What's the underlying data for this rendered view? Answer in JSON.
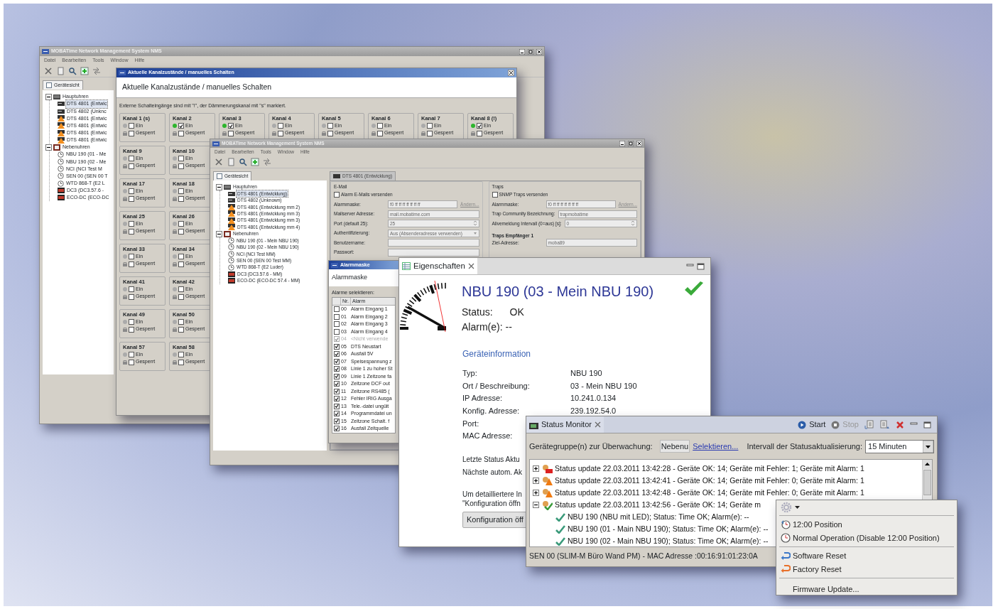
{
  "main_window": {
    "title": "MOBATime Network Management System NMS",
    "menu": [
      "Datei",
      "Bearbeiten",
      "Tools",
      "Window",
      "Hilfe"
    ],
    "view_tab": "Gerätesicht",
    "tree": [
      {
        "kind": "group-main",
        "label": "Hauptuhren",
        "expanded": true,
        "selected": false,
        "children": [
          {
            "kind": "device",
            "label": "DTS 4801 (Entwic",
            "selected": true
          },
          {
            "kind": "device",
            "label": "DTS 4802 (Unknc",
            "selected": false
          },
          {
            "kind": "warning",
            "label": "DTS 4801 (Entwic",
            "selected": false
          },
          {
            "kind": "warning",
            "label": "DTS 4801 (Entwic",
            "selected": false
          },
          {
            "kind": "warning",
            "label": "DTS 4801 (Entwic",
            "selected": false
          },
          {
            "kind": "warning",
            "label": "DTS 4801 (Entwic",
            "selected": false
          }
        ]
      },
      {
        "kind": "group-sub",
        "label": "Nebenuhren",
        "expanded": true,
        "selected": false,
        "children": [
          {
            "kind": "clock",
            "label": "NBU 190 (01 - Me",
            "selected": false
          },
          {
            "kind": "clock",
            "label": "NBU 190 (02 - Me",
            "selected": false
          },
          {
            "kind": "clock",
            "label": "NCI (NCI Test M",
            "selected": false
          },
          {
            "kind": "clock",
            "label": "SEN 00 (SEN 00 T",
            "selected": false
          },
          {
            "kind": "clock",
            "label": "WTD 868-T (E2 L",
            "selected": false
          },
          {
            "kind": "red-device",
            "label": "DC3 (DC3.57.6 -",
            "selected": false
          },
          {
            "kind": "red-device",
            "label": "ECO-DC (ECO-DC",
            "selected": false
          }
        ]
      }
    ]
  },
  "channel_dialog": {
    "title": "Aktuelle Kanalzustände / manuelles Schalten",
    "heading": "Aktuelle Kanalzustände / manuelles Schalten",
    "note": "Externe Schalteingänge sind mit \"!\", der Dämmerungskanal mit \"s\" markiert.",
    "channels": [
      {
        "title": "Kanal 1 (s)",
        "active": false,
        "options": [
          {
            "label": "Ein",
            "checked": false
          },
          {
            "label": "Gesperrt",
            "checked": false
          }
        ]
      },
      {
        "title": "Kanal 2",
        "active": true,
        "options": [
          {
            "label": "Ein",
            "checked": true
          },
          {
            "label": "Gesperrt",
            "checked": false
          }
        ]
      },
      {
        "title": "Kanal 3",
        "active": true,
        "options": [
          {
            "label": "Ein",
            "checked": true
          },
          {
            "label": "Gesperrt",
            "checked": false
          }
        ]
      },
      {
        "title": "Kanal 4",
        "active": false,
        "options": [
          {
            "label": "Ein",
            "checked": false
          },
          {
            "label": "Gesperrt",
            "checked": false
          }
        ]
      },
      {
        "title": "Kanal 5",
        "active": false,
        "options": [
          {
            "label": "Ein",
            "checked": false
          },
          {
            "label": "Gesperrt",
            "checked": false
          }
        ]
      },
      {
        "title": "Kanal 6",
        "active": false,
        "options": [
          {
            "label": "Ein",
            "checked": false
          },
          {
            "label": "Gesperrt",
            "checked": false
          }
        ]
      },
      {
        "title": "Kanal 7",
        "active": false,
        "options": [
          {
            "label": "Ein",
            "checked": false
          },
          {
            "label": "Gesperrt",
            "checked": false
          }
        ]
      },
      {
        "title": "Kanal 8 (!)",
        "active": true,
        "options": [
          {
            "label": "Ein",
            "checked": true
          },
          {
            "label": "Gesperrt",
            "checked": false
          }
        ]
      },
      {
        "title": "Kanal 9",
        "active": false,
        "options": [
          {
            "label": "Ein",
            "checked": false
          },
          {
            "label": "Gesperrt",
            "checked": false
          }
        ]
      },
      {
        "title": "Kanal 10",
        "active": false,
        "options": [
          {
            "label": "Ein",
            "checked": false
          },
          {
            "label": "Gesperrt",
            "checked": false
          }
        ]
      },
      {
        "title": "Kanal 17",
        "active": false,
        "options": [
          {
            "label": "Ein",
            "checked": false
          },
          {
            "label": "Gesperrt",
            "checked": false
          }
        ]
      },
      {
        "title": "Kanal 18",
        "active": false,
        "options": [
          {
            "label": "Ein",
            "checked": false
          },
          {
            "label": "Gesperrt",
            "checked": false
          }
        ]
      },
      {
        "title": "Kanal 25",
        "active": false,
        "options": [
          {
            "label": "Ein",
            "checked": false
          },
          {
            "label": "Gesperrt",
            "checked": false
          }
        ]
      },
      {
        "title": "Kanal 26",
        "active": false,
        "options": [
          {
            "label": "Ein",
            "checked": false
          },
          {
            "label": "Gesperrt",
            "checked": false
          }
        ]
      },
      {
        "title": "Kanal 33",
        "active": false,
        "options": [
          {
            "label": "Ein",
            "checked": false
          },
          {
            "label": "Gesperrt",
            "checked": false
          }
        ]
      },
      {
        "title": "Kanal 34",
        "active": false,
        "options": [
          {
            "label": "Ein",
            "checked": false
          },
          {
            "label": "Gesperrt",
            "checked": false
          }
        ]
      },
      {
        "title": "Kanal 41",
        "active": false,
        "options": [
          {
            "label": "Ein",
            "checked": false
          },
          {
            "label": "Gesperrt",
            "checked": false
          }
        ]
      },
      {
        "title": "Kanal 42",
        "active": false,
        "options": [
          {
            "label": "Ein",
            "checked": false
          },
          {
            "label": "Gesperrt",
            "checked": false
          }
        ]
      },
      {
        "title": "Kanal 49",
        "active": false,
        "options": [
          {
            "label": "Ein",
            "checked": false
          },
          {
            "label": "Gesperrt",
            "checked": false
          }
        ]
      },
      {
        "title": "Kanal 50",
        "active": false,
        "options": [
          {
            "label": "Ein",
            "checked": false
          },
          {
            "label": "Gesperrt",
            "checked": false
          }
        ]
      },
      {
        "title": "Kanal 57",
        "active": false,
        "options": [
          {
            "label": "Ein",
            "checked": false
          },
          {
            "label": "Gesperrt",
            "checked": false
          }
        ]
      },
      {
        "title": "Kanal 58",
        "active": false,
        "options": [
          {
            "label": "Ein",
            "checked": false
          },
          {
            "label": "Gesperrt",
            "checked": false
          }
        ]
      }
    ]
  },
  "second_window": {
    "title": "MOBATime Network Management System NMS",
    "menu": [
      "Datei",
      "Bearbeiten",
      "Tools",
      "Window",
      "Hilfe"
    ],
    "view_tab": "Gerätesicht",
    "tree": [
      {
        "kind": "group-main",
        "label": "Hauptuhren",
        "expanded": true,
        "selected": false,
        "children": [
          {
            "kind": "device",
            "label": "DTS 4801 (Entwicklung)",
            "selected": true
          },
          {
            "kind": "device",
            "label": "DTS 4802 (Unknown)",
            "selected": false
          },
          {
            "kind": "warning",
            "label": "DTS 4801 (Entwicklung mm 2)",
            "selected": false
          },
          {
            "kind": "warning",
            "label": "DTS 4801 (Entwicklung mm 3)",
            "selected": false
          },
          {
            "kind": "warning",
            "label": "DTS 4801 (Entwicklung mm 3)",
            "selected": false
          },
          {
            "kind": "warning",
            "label": "DTS 4801 (Entwicklung mm 4)",
            "selected": false
          }
        ]
      },
      {
        "kind": "group-sub",
        "label": "Nebenuhren",
        "expanded": true,
        "selected": false,
        "children": [
          {
            "kind": "clock",
            "label": "NBU 190 (01 - Mein NBU 190)",
            "selected": false
          },
          {
            "kind": "clock",
            "label": "NBU 190 (02 - Mein NBU 190)",
            "selected": false
          },
          {
            "kind": "clock",
            "label": "NCI (NCI Test MM)",
            "selected": false
          },
          {
            "kind": "clock",
            "label": "SEN 00 (SEN 00 Test MM)",
            "selected": false
          },
          {
            "kind": "clock",
            "label": "WTD 868-T (E2 Luder)",
            "selected": false
          },
          {
            "kind": "red-device",
            "label": "DC3 (DC3.57.6 - MM)",
            "selected": false
          },
          {
            "kind": "red-device",
            "label": "ECO-DC (ECO-DC 57.4 - MM)",
            "selected": false
          }
        ]
      }
    ],
    "editor_tab": "DTS 4801 (Entwicklung)",
    "groups": [
      {
        "title": "E-Mail",
        "checkbox": {
          "label": "Alarm E-Mails versenden",
          "checked": false
        },
        "fields": [
          {
            "kind": "text",
            "label": "Alarmmaske:",
            "value": "f0 ff ff ff ff ff ff ff",
            "action": "Ändern..."
          },
          {
            "kind": "text",
            "label": "Mailserver Adresse:",
            "value": "mail.mobatime.com"
          },
          {
            "kind": "spin",
            "label": "Port (default 25):",
            "value": "25"
          },
          {
            "kind": "select",
            "label": "Authentifizierung:",
            "value": "Aus (Absenderadresse verwenden)"
          },
          {
            "kind": "text",
            "label": "Benutzername:"
          },
          {
            "kind": "text",
            "label": "Passwort:"
          }
        ]
      },
      {
        "title": "Traps",
        "checkbox": {
          "label": "SNMP Traps versenden",
          "checked": false
        },
        "fields": [
          {
            "kind": "text",
            "label": "Alarmmaske:",
            "value": "f0 ff ff ff ff ff ff ff",
            "action": "Ändern..."
          },
          {
            "kind": "text",
            "label": "Trap Community Bezeichnung:",
            "value": "trapmobatime"
          },
          {
            "kind": "spin",
            "label": "Alivemeldung Intervall (0=aus) [s]:",
            "value": "0"
          },
          {
            "kind": "heading",
            "label": "Traps Empfänger 1"
          },
          {
            "kind": "text",
            "label": "Ziel-Adresse:",
            "value": "moba89"
          }
        ]
      }
    ]
  },
  "alarm_dialog": {
    "title": "Alarmmaske",
    "heading": "Alarmmaske",
    "prompt": "Alarme selektieren:",
    "columns": [
      "Nr.",
      "Alarm"
    ],
    "rows": [
      {
        "nr": "00",
        "alarm": "Alarm Eingang 1",
        "checked": false,
        "disabled": false
      },
      {
        "nr": "01",
        "alarm": "Alarm Eingang 2",
        "checked": false,
        "disabled": false
      },
      {
        "nr": "02",
        "alarm": "Alarm Eingang 3",
        "checked": false,
        "disabled": false
      },
      {
        "nr": "03",
        "alarm": "Alarm Eingang 4",
        "checked": false,
        "disabled": false
      },
      {
        "nr": "04",
        "alarm": "<Nicht verwende",
        "checked": true,
        "disabled": true
      },
      {
        "nr": "05",
        "alarm": "DTS Neustart",
        "checked": true,
        "disabled": false
      },
      {
        "nr": "06",
        "alarm": "Ausfall 5V",
        "checked": true,
        "disabled": false
      },
      {
        "nr": "07",
        "alarm": "Speisespannung z",
        "checked": true,
        "disabled": false
      },
      {
        "nr": "08",
        "alarm": "Linie 1 zu hoher St",
        "checked": true,
        "disabled": false
      },
      {
        "nr": "09",
        "alarm": "Linie 1 Zeitzone fa",
        "checked": true,
        "disabled": false
      },
      {
        "nr": "10",
        "alarm": "Zeitzone DCF out",
        "checked": true,
        "disabled": false
      },
      {
        "nr": "11",
        "alarm": "Zeitzone RS485 (",
        "checked": true,
        "disabled": false
      },
      {
        "nr": "12",
        "alarm": "Fehler IRIG Ausga",
        "checked": true,
        "disabled": false
      },
      {
        "nr": "13",
        "alarm": "Tele.-datei ungült",
        "checked": true,
        "disabled": false
      },
      {
        "nr": "14",
        "alarm": "Programmdatei un",
        "checked": true,
        "disabled": false
      },
      {
        "nr": "15",
        "alarm": "Zeitzone Schalt. f",
        "checked": true,
        "disabled": false
      },
      {
        "nr": "16",
        "alarm": "Ausfall Zeitquelle",
        "checked": true,
        "disabled": false
      }
    ]
  },
  "properties": {
    "tab": "Eigenschaften",
    "device_title": "NBU 190 (03 - Mein NBU 190)",
    "status_label": "Status:",
    "status_value": "OK",
    "alarm_label": "Alarm(e):",
    "alarm_value": "--",
    "section": "Geräteinformation",
    "info": [
      {
        "label": "Typ:",
        "value": "NBU 190"
      },
      {
        "label": "Ort / Beschreibung:",
        "value": "03 - Mein NBU 190"
      },
      {
        "label": "IP Adresse:",
        "value": "10.241.0.134"
      },
      {
        "label": "Konfig. Adresse:",
        "value": "239.192.54.0"
      },
      {
        "label": "Port:"
      },
      {
        "label": "MAC Adresse:"
      }
    ],
    "update_lines": [
      "Letzte Status Aktu",
      "Nächste autom. Ak"
    ],
    "hint_lines": [
      "Um detailliertere In",
      "\"Konfiguration öffn"
    ],
    "button": "Konfiguration öff"
  },
  "status_monitor": {
    "tab": "Status Monitor",
    "start": "Start",
    "stop": "Stop",
    "stop_disabled": true,
    "group_label": "Gerätegruppe(n) zur Überwachung:",
    "group_value": "Nebenu",
    "select_link": "Selektieren...",
    "interval_label": "Intervall der Statusaktualisierung:",
    "interval_value": "15 Minuten",
    "updates": [
      {
        "kind": "error",
        "expanded": false,
        "text": "Status update 22.03.2011 13:42:28  -  Geräte OK: 14;  Geräte mit Fehler: 1;  Geräte mit Alarm: 1"
      },
      {
        "kind": "warning",
        "expanded": false,
        "text": "Status update 22.03.2011 13:42:41  -  Geräte OK: 14;  Geräte mit Fehler: 0;  Geräte mit Alarm: 1"
      },
      {
        "kind": "warning",
        "expanded": false,
        "text": "Status update 22.03.2011 13:42:48  -  Geräte OK: 14;  Geräte mit Fehler: 0;  Geräte mit Alarm: 1"
      },
      {
        "kind": "ok",
        "expanded": true,
        "text": "Status update 22.03.2011 13:42:56  -  Geräte OK: 14;  Geräte m",
        "children": [
          {
            "kind": "ok",
            "text": "NBU 190 (NBU mit LED); Status: Time OK; Alarm(e): --"
          },
          {
            "kind": "ok",
            "text": "NBU 190 (01 - Main NBU 190); Status: Time OK; Alarm(e): --"
          },
          {
            "kind": "ok",
            "text": "NBU 190 (02 - Main NBU 190); Status: Time OK; Alarm(e): --"
          }
        ]
      }
    ],
    "status_bar": "SEN 00 (SLIM-M Büro Wand PM) - MAC Adresse :00:16:91:01:23:0A"
  },
  "context_menu": {
    "items": [
      {
        "kind": "clock-arrow",
        "label": "12:00 Position"
      },
      {
        "kind": "clock",
        "label": "Normal Operation (Disable 12:00 Position)"
      },
      {
        "kind": "separator"
      },
      {
        "kind": "reset-blue",
        "label": "Software Reset"
      },
      {
        "kind": "reset-orange",
        "label": "Factory Reset"
      },
      {
        "kind": "separator"
      },
      {
        "kind": "plain",
        "label": "Firmware Update..."
      }
    ]
  }
}
